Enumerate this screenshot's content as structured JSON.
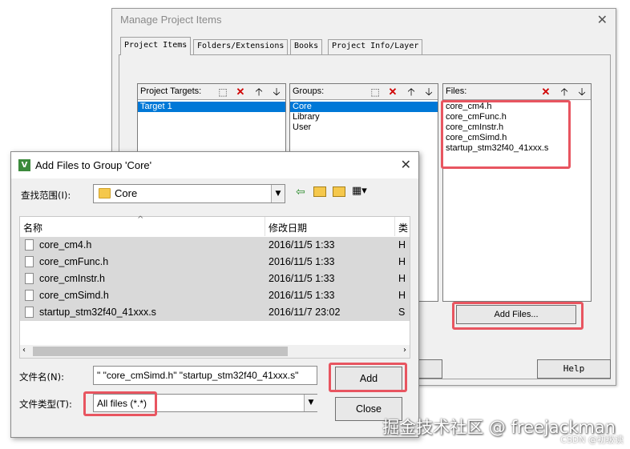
{
  "manage_dialog": {
    "title": "Manage Project Items",
    "close": "✕",
    "tabs": [
      "Project Items",
      "Folders/Extensions",
      "Books",
      "Project Info/Layer"
    ],
    "targets": {
      "label": "Project Targets:",
      "items": [
        "Target 1"
      ]
    },
    "groups": {
      "label": "Groups:",
      "items": [
        "Core",
        "Library",
        "User"
      ]
    },
    "files": {
      "label": "Files:",
      "items": [
        "core_cm4.h",
        "core_cmFunc.h",
        "core_cmInstr.h",
        "core_cmSimd.h",
        "startup_stm32f40_41xxx.s"
      ]
    },
    "add_files_button": "Add Files...",
    "help_button": "Help"
  },
  "add_dialog": {
    "title": "Add Files to Group 'Core'",
    "close": "✕",
    "look_in_label": "查找范围(I):",
    "look_in_value": "Core",
    "columns": {
      "name": "名称",
      "date": "修改日期",
      "type": "类"
    },
    "files": [
      {
        "name": "core_cm4.h",
        "date": "2016/11/5 1:33",
        "type": "H"
      },
      {
        "name": "core_cmFunc.h",
        "date": "2016/11/5 1:33",
        "type": "H"
      },
      {
        "name": "core_cmInstr.h",
        "date": "2016/11/5 1:33",
        "type": "H"
      },
      {
        "name": "core_cmSimd.h",
        "date": "2016/11/5 1:33",
        "type": "H"
      },
      {
        "name": "startup_stm32f40_41xxx.s",
        "date": "2016/11/7 23:02",
        "type": "S"
      }
    ],
    "filename_label": "文件名(N):",
    "filename_value": "\" \"core_cmSimd.h\" \"startup_stm32f40_41xxx.s\"",
    "filetype_label": "文件类型(T):",
    "filetype_value": "All files (*.*)",
    "add_button": "Add",
    "close_button": "Close"
  },
  "watermark": "掘金技术社区 @ freejackman",
  "csdn_mark": "CSDN @初级读",
  "colors": {
    "highlight": "#e85560",
    "selection": "#0078d7"
  }
}
